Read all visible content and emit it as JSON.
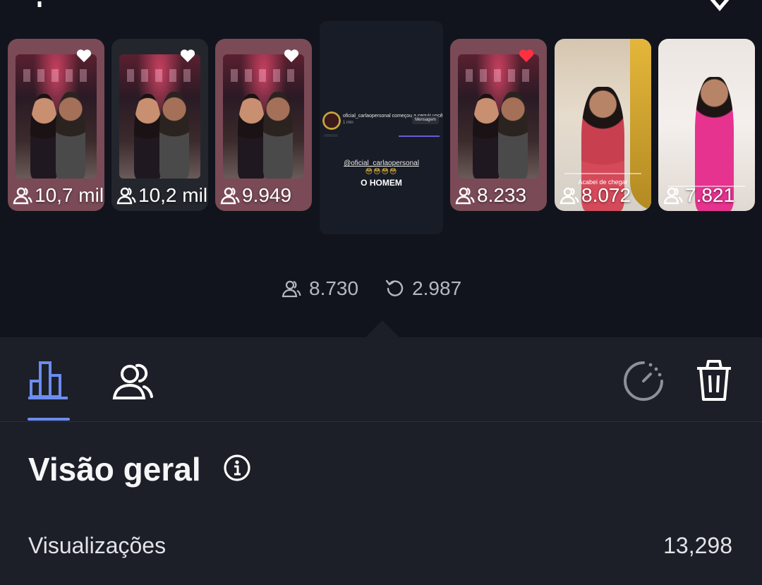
{
  "header": {
    "settings_icon": "gear-icon",
    "close_icon": "close-icon"
  },
  "stories": [
    {
      "viewers": "10,7 mil",
      "liked": true,
      "heart_color": "#ffffff",
      "scene": "gym"
    },
    {
      "viewers": "10,2 mil",
      "liked": true,
      "heart_color": "#ffffff",
      "scene": "gym"
    },
    {
      "viewers": "9.949",
      "liked": true,
      "heart_color": "#ffffff",
      "scene": "gym"
    },
    {
      "viewers": "8.233",
      "liked": true,
      "heart_color": "#ff3040",
      "scene": "gym"
    },
    {
      "viewers": "8.072",
      "liked": false,
      "heart_color": "",
      "scene": "store",
      "overlay_text": "Acabei de chegar"
    },
    {
      "viewers": "7.821",
      "liked": false,
      "heart_color": "",
      "scene": "pink"
    }
  ],
  "current_story": {
    "handle": "@oficial_carlaopersonal",
    "username": "oficial_carlaopersonal",
    "action": "começou a seguir você",
    "time": "1 min",
    "message_button": "Mensagem",
    "emoji": "😳😳😳😳",
    "title": "O HOMEM",
    "viewers": "8.730",
    "replays": "2.987"
  },
  "tabs": {
    "insights_icon": "bar-chart-icon",
    "viewers_icon": "viewers-icon",
    "timer_icon": "timer-icon",
    "delete_icon": "trash-icon"
  },
  "overview": {
    "title": "Visão geral",
    "info_icon": "info-icon",
    "metrics": [
      {
        "label": "Visualizações",
        "value": "13,298"
      }
    ]
  },
  "colors": {
    "accent": "#6b8df0",
    "background": "#11141d",
    "panel": "#1c1f27"
  }
}
